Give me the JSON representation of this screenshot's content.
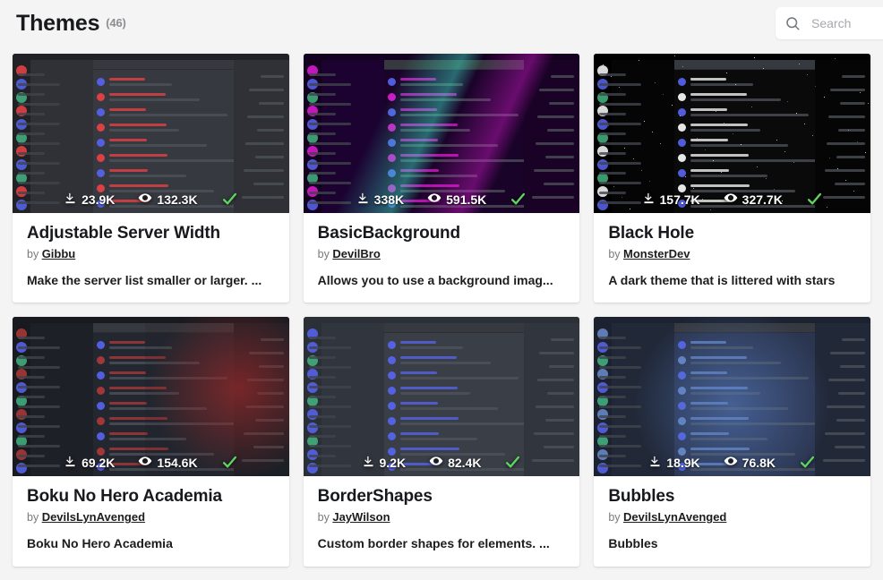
{
  "header": {
    "title": "Themes",
    "count": "(46)",
    "search_placeholder": "Search",
    "search_value": "",
    "search_icon": "search-icon"
  },
  "icons": {
    "download": "download-icon",
    "views": "eye-icon",
    "verified": "check-icon"
  },
  "colors": {
    "page_background": "#f4f4f4",
    "card_background": "#ffffff",
    "title_text": "#18191c",
    "muted_text": "#787a7e",
    "verified_green": "#5fd35f"
  },
  "cards": [
    {
      "title": "Adjustable Server Width",
      "by_label": "by",
      "author": "Gibbu",
      "description": "Make the server list smaller or larger. ...",
      "downloads": "23.9K",
      "views": "132.3K",
      "verified": true,
      "thumb_style": "dark-classic"
    },
    {
      "title": "BasicBackground",
      "by_label": "by",
      "author": "DevilBro",
      "description": "Allows you to use a background imag...",
      "downloads": "338K",
      "views": "591.5K",
      "verified": true,
      "thumb_style": "neon-purple"
    },
    {
      "title": "Black Hole",
      "by_label": "by",
      "author": "MonsterDev",
      "description": "A dark theme that is littered with stars",
      "downloads": "157.7K",
      "views": "327.7K",
      "verified": true,
      "thumb_style": "black-stars"
    },
    {
      "title": "Boku No Hero Academia",
      "by_label": "by",
      "author": "DevilsLynAvenged",
      "description": "Boku No Hero Academia",
      "downloads": "69.2K",
      "views": "154.6K",
      "verified": true,
      "thumb_style": "anime-red"
    },
    {
      "title": "BorderShapes",
      "by_label": "by",
      "author": "JayWilson",
      "description": "Custom border shapes for elements. ...",
      "downloads": "9.2K",
      "views": "82.4K",
      "verified": true,
      "thumb_style": "light-blue"
    },
    {
      "title": "Bubbles",
      "by_label": "by",
      "author": "DevilsLynAvenged",
      "description": "Bubbles",
      "downloads": "18.9K",
      "views": "76.8K",
      "verified": true,
      "thumb_style": "blue-space"
    }
  ]
}
